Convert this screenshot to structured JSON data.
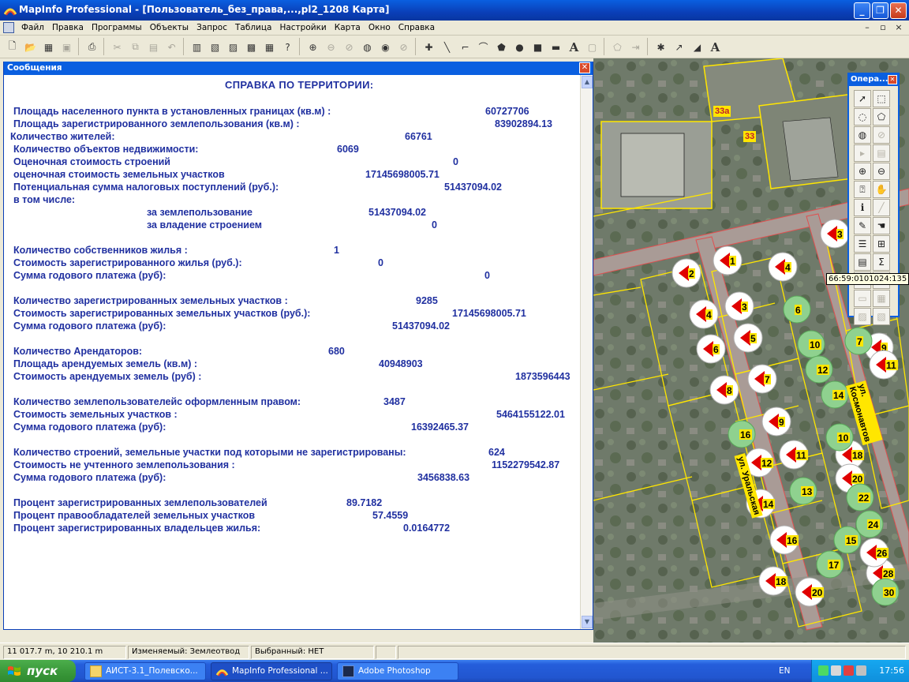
{
  "window": {
    "title": "MapInfo Professional - [Пользователь_без_права,...,pl2_1208 Карта]",
    "minimize": "_",
    "maximize": "❐",
    "close": "✕"
  },
  "menu": {
    "items": [
      "Файл",
      "Правка",
      "Программы",
      "Объекты",
      "Запрос",
      "Таблица",
      "Настройки",
      "Карта",
      "Окно",
      "Справка"
    ],
    "mdi_controls": [
      "–",
      "▫",
      "×"
    ]
  },
  "messages": {
    "title": "Сообщения",
    "close": "✕",
    "heading": "СПРАВКА ПО ТЕРРИТОРИИ:",
    "lines": [
      {
        "label": "Площадь  населенного пункта в установленных границах (кв.м) :",
        "value": "60727706"
      },
      {
        "label": "Площадь  зарегистрированного землепользования (кв.м) :",
        "value": "83902894.13"
      },
      {
        "label": "Количество жителей:",
        "value": "66761"
      },
      {
        "label": "Количество объектов недвижимости:",
        "value": "6069"
      },
      {
        "label": "Оценочная стоимость  строений",
        "value": "0"
      },
      {
        "label": "оценочная стоимость земельных участков",
        "value": "17145698005.71"
      },
      {
        "label": "Потенциальная сумма налоговых поступлений (руб.):",
        "value": "51437094.02"
      },
      {
        "label": "в том числе:",
        "value": ""
      },
      {
        "label": "за землепользование",
        "value": "51437094.02"
      },
      {
        "label": "за владение строением",
        "value": "0"
      },
      {
        "label": "Количество собственников жилья :",
        "value": "1"
      },
      {
        "label": "Стоимость зарегистрированного жилья (руб.):",
        "value": "0"
      },
      {
        "label": "Сумма годового платежа (руб):",
        "value": "0"
      },
      {
        "label": "Количество зарегистрированных земельных участков :",
        "value": "9285"
      },
      {
        "label": "Стоимость зарегистрированных земельных участков (руб.):",
        "value": "17145698005.71"
      },
      {
        "label": "Сумма годового платежа (руб):",
        "value": "51437094.02"
      },
      {
        "label": "Количество Арендаторов:",
        "value": "680"
      },
      {
        "label": "Площадь арендуемых земель (кв.м) :",
        "value": "40948903"
      },
      {
        "label": "Стоимость арендуемых земель (руб) :",
        "value": "1873596443"
      },
      {
        "label": "Количество  землепользователейс оформленным правом:",
        "value": "3487"
      },
      {
        "label": "Стоимость земельных участков :",
        "value": "5464155122.01"
      },
      {
        "label": "Сумма годового платежа (руб):",
        "value": "16392465.37"
      },
      {
        "label": "Количество строений, земельные участки под которыми не зарегистрированы:",
        "value": "624"
      },
      {
        "label": "Стоимость не учтенного землепользования  :",
        "value": "1152279542.87"
      },
      {
        "label": "Сумма годового платежа (руб):",
        "value": "3456838.63"
      },
      {
        "label": "Процент зарегистрированных землепользователей",
        "value": "89.7182"
      },
      {
        "label": "Процент правообладателей  земельных участков",
        "value": "57.4559"
      },
      {
        "label": "Процент зарегистрированных владельцев жилья:",
        "value": "0.0164772"
      }
    ]
  },
  "ops_toolbar": {
    "title": "Опера...",
    "close": "✕",
    "tooltip": "66:59:0101024:135"
  },
  "map": {
    "labels": {
      "plot_33a": "33а",
      "plot_33": "33",
      "street_uralskaya": "ул. Уральская",
      "street_kosmonavtov": "ул. Космонавтов"
    },
    "red_markers": [
      "1",
      "2",
      "4",
      "3",
      "4",
      "5",
      "6",
      "7",
      "8",
      "9",
      "11",
      "12",
      "14",
      "16",
      "18",
      "20",
      "3",
      "9",
      "11",
      "18",
      "20",
      "28",
      "26"
    ],
    "green_markers": [
      "6",
      "10",
      "12",
      "14",
      "16",
      "10",
      "13",
      "15",
      "17",
      "22",
      "24",
      "30",
      "7"
    ]
  },
  "statusbar": {
    "coords": "11 017.7 m, 10 210.1 m",
    "editable": "Изменяемый: Землеотвод",
    "selected": "Выбранный: НЕТ"
  },
  "taskbar": {
    "start": "пуск",
    "tasks": [
      "АИСТ-3.1_Полевско...",
      "MapInfo Professional ...",
      "Adobe Photoshop"
    ],
    "lang": "EN",
    "clock": "17:56"
  }
}
